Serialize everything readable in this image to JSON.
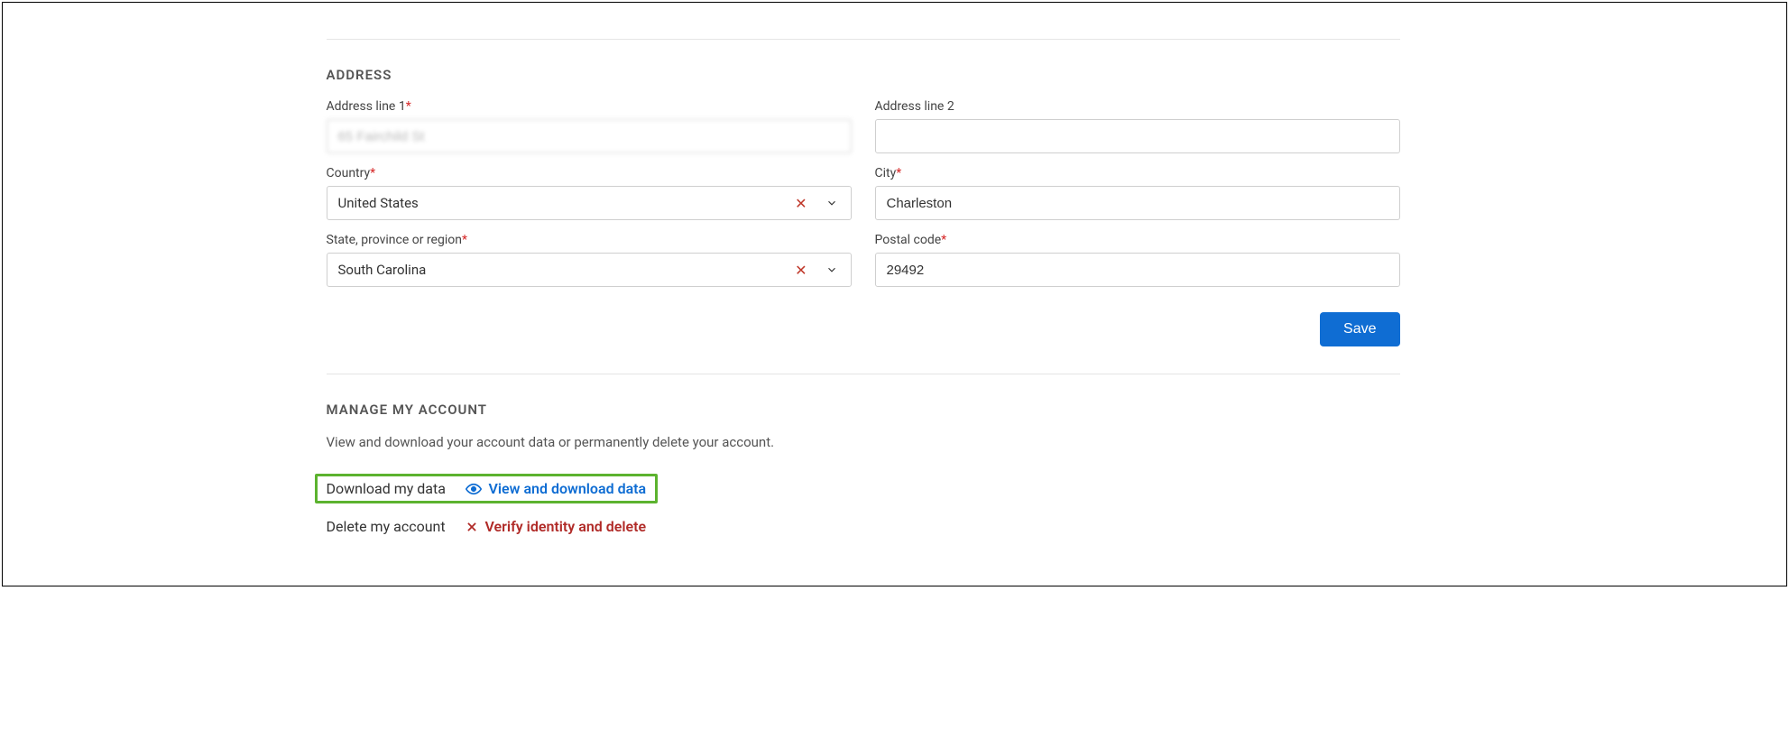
{
  "address": {
    "heading": "ADDRESS",
    "line1_label": "Address line 1",
    "line1_value": "65 Fairchild St",
    "line2_label": "Address line 2",
    "line2_value": "",
    "country_label": "Country",
    "country_value": "United States",
    "city_label": "City",
    "city_value": "Charleston",
    "state_label": "State, province or region",
    "state_value": "South Carolina",
    "postal_label": "Postal code",
    "postal_value": "29492",
    "save_label": "Save"
  },
  "manage": {
    "heading": "MANAGE MY ACCOUNT",
    "subtext": "View and download your account data or permanently delete your account.",
    "download_label": "Download my data",
    "download_action": "View and download data",
    "delete_label": "Delete my account",
    "delete_action": "Verify identity and delete"
  },
  "required_marker": "*",
  "colors": {
    "primary": "#0f6dd3",
    "danger": "#b02a27",
    "highlight": "#5cb32f"
  }
}
